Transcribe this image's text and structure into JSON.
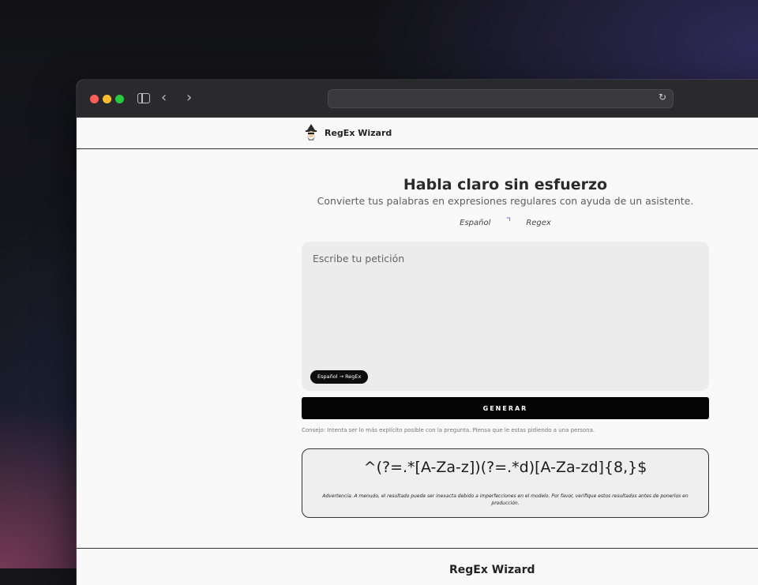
{
  "browser": {
    "url": "",
    "reload_icon": "↻",
    "back_icon": "‹",
    "forward_icon": "›"
  },
  "nav": {
    "brand": "RegEx Wizard",
    "logo_icon": "wizard-icon"
  },
  "hero": {
    "title": "Habla claro sin esfuerzo",
    "subtitle": "Convierte tus palabras en expresiones regulares con ayuda de un asistente.",
    "source_lang": "Español",
    "target_lang": "Regex",
    "swap_icon": "⌝"
  },
  "prompt": {
    "placeholder": "Escribe tu petición",
    "value": "",
    "mode_label": "Español → RegEx"
  },
  "generate": {
    "label": "GENERAR"
  },
  "tip": "Consejo: Intenta ser lo más explícito posible con la pregunta. Piensa que le estas pidiendo a una persona.",
  "result": {
    "regex": "^(?=.*[A-Za-z])(?=.*d)[A-Za-zd]{8,}$",
    "warning": "Advertencia: A menudo, el resultado puede ser inexacta debido a imperfecciones en el modelo. Por favor, verifique estos resultados antes de ponerlos en producción."
  },
  "footer": {
    "brand": "RegEx Wizard"
  },
  "colors": {
    "accent": "#7a6fd0",
    "button": "#050505",
    "page_bg": "#faf9f9"
  }
}
